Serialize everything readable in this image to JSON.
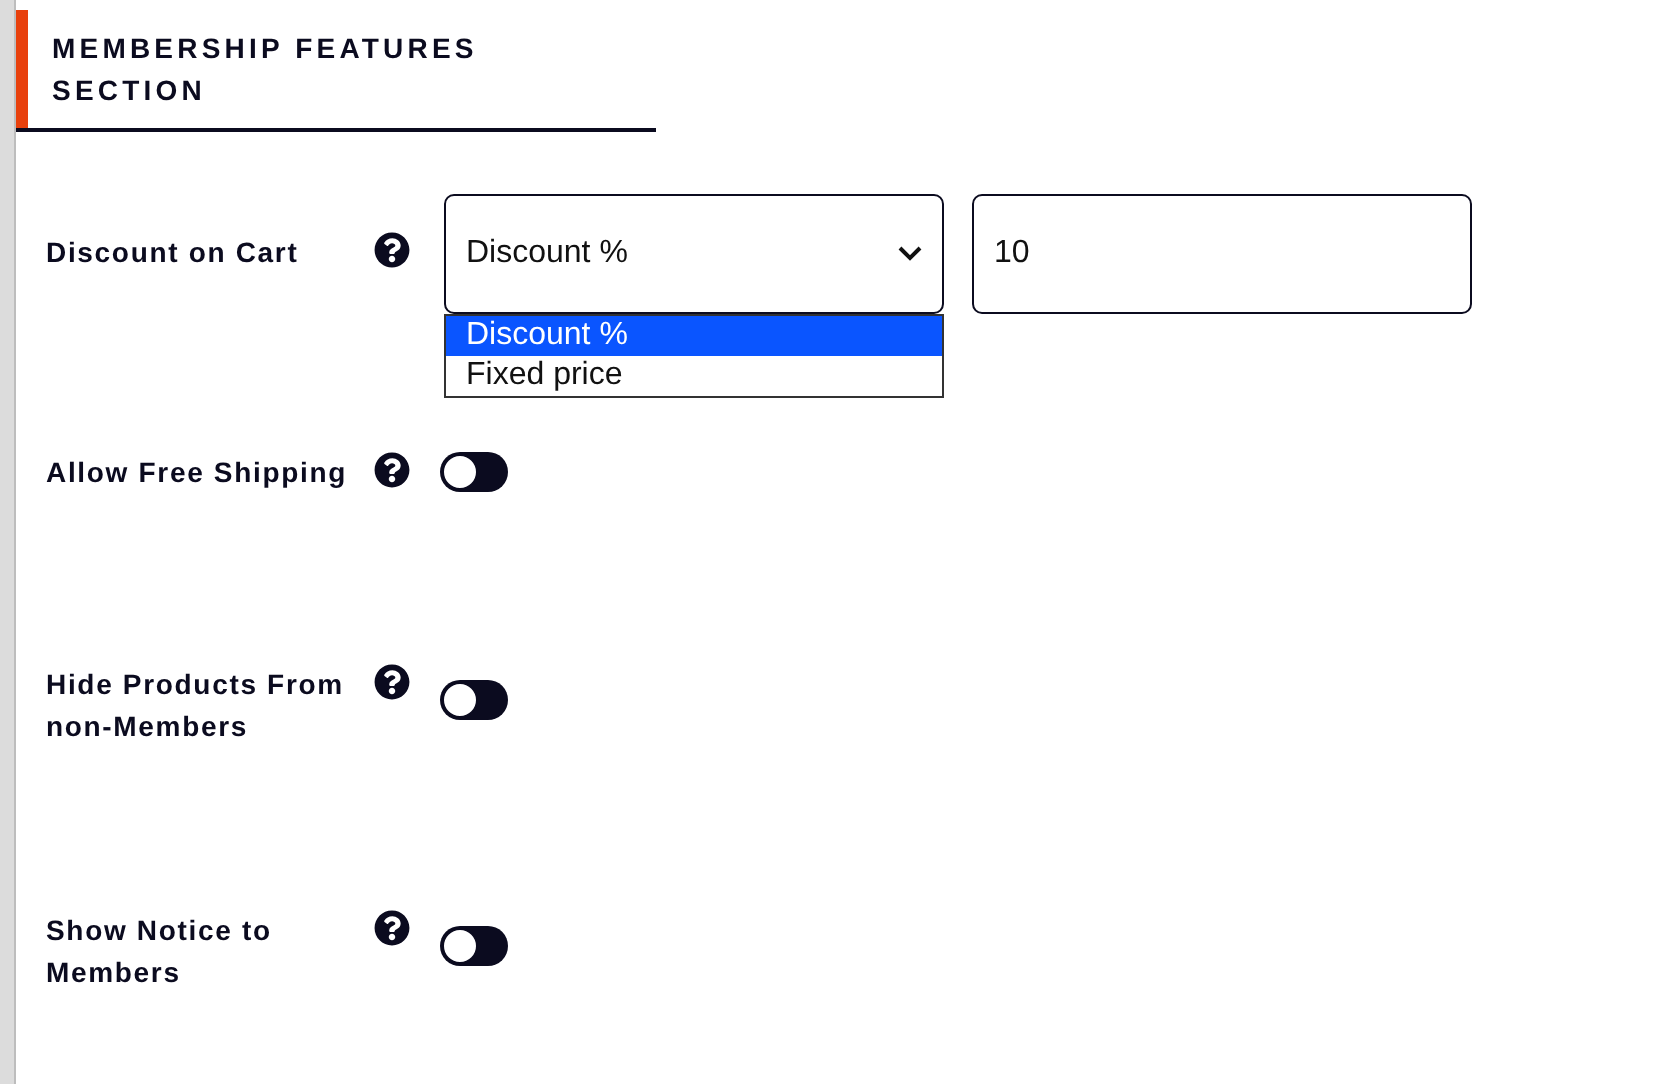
{
  "section": {
    "title": "MEMBERSHIP FEATURES SECTION"
  },
  "discount": {
    "label": "Discount on Cart",
    "select_value": "Discount %",
    "options": [
      {
        "label": "Discount %",
        "selected": true
      },
      {
        "label": "Fixed price",
        "selected": false
      }
    ],
    "amount": "10"
  },
  "toggles": [
    {
      "label": "Allow Free Shipping",
      "on": false
    },
    {
      "label": "Hide Products From non-Members",
      "on": false
    },
    {
      "label": "Show Notice to Members",
      "on": false
    }
  ]
}
